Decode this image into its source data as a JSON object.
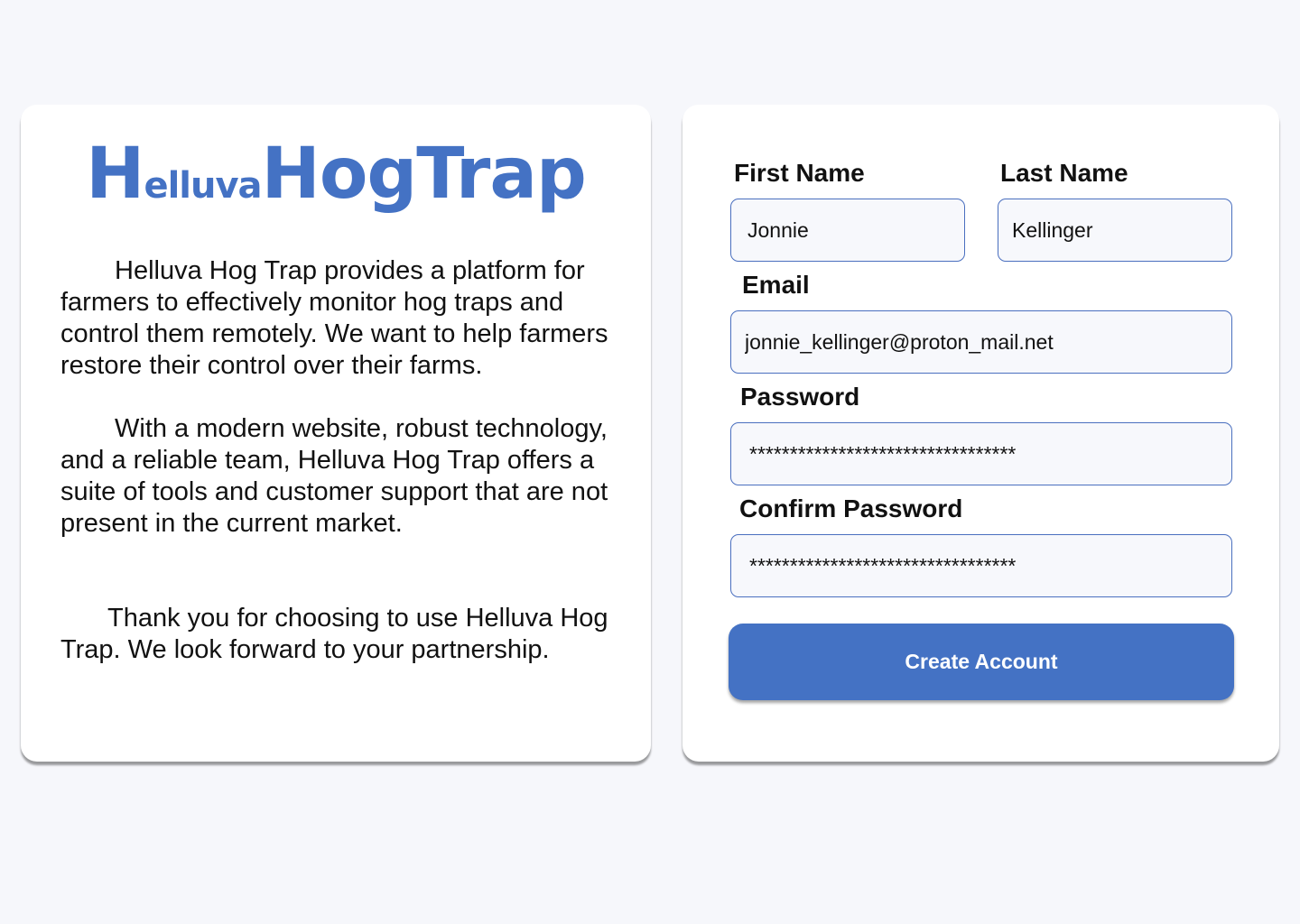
{
  "brand": {
    "logo_part_1": "H",
    "logo_part_2": "elluva",
    "logo_part_3": "H",
    "logo_part_4": "og",
    "logo_part_5": "T",
    "logo_part_6": "rap",
    "logo_full": "HelluvaHogTrap",
    "color": "#4472C4"
  },
  "about": {
    "paragraphs": [
      "Helluva Hog Trap provides a platform for farmers to effectively monitor hog traps and control them remotely. We want to help farmers restore their control over their farms.",
      "With a modern website, robust technology, and a reliable team, Helluva Hog Trap offers a suite of tools and customer support that are not present in the current market.",
      "Thank you for choosing to use Helluva Hog Trap. We look forward to your partnership."
    ]
  },
  "form": {
    "first_name": {
      "label": "First Name",
      "value": "Jonnie"
    },
    "last_name": {
      "label": "Last Name",
      "value": "Kellinger"
    },
    "email": {
      "label": "Email",
      "value": "jonnie_kellinger@proton_mail.net"
    },
    "password": {
      "label": "Password",
      "value": "*********************************"
    },
    "confirm_password": {
      "label": "Confirm Password",
      "value": "*********************************"
    },
    "submit_label": "Create Account"
  },
  "colors": {
    "accent": "#4472C4",
    "page_background": "#F6F7FB",
    "card_background": "#FFFFFF",
    "input_border": "#4A6FBF"
  }
}
